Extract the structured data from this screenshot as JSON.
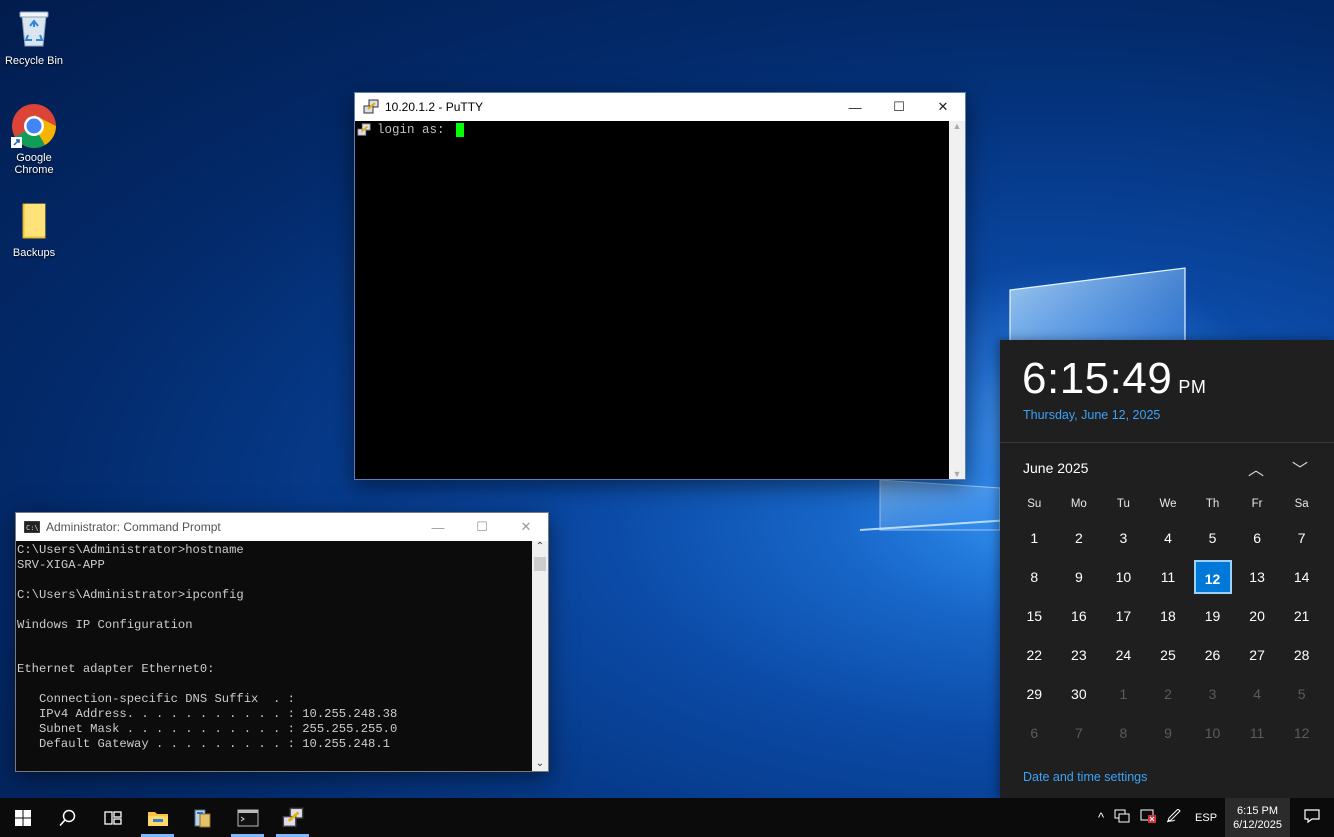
{
  "desktop": {
    "icons": [
      {
        "label": "Recycle Bin"
      },
      {
        "label": "Google\nChrome"
      },
      {
        "label": "Backups"
      }
    ]
  },
  "putty": {
    "title": "10.20.1.2 - PuTTY",
    "prompt": "login as: "
  },
  "cmd": {
    "title": "Administrator: Command Prompt",
    "output": "C:\\Users\\Administrator>hostname\nSRV-XIGA-APP\n\nC:\\Users\\Administrator>ipconfig\n\nWindows IP Configuration\n\n\nEthernet adapter Ethernet0:\n\n   Connection-specific DNS Suffix  . :\n   IPv4 Address. . . . . . . . . . . : 10.255.248.38\n   Subnet Mask . . . . . . . . . . . : 255.255.255.0\n   Default Gateway . . . . . . . . . : 10.255.248.1"
  },
  "flyout": {
    "time": "6:15:49",
    "ampm": "PM",
    "date": "Thursday, June 12, 2025",
    "month": "June 2025",
    "weekdays": [
      "Su",
      "Mo",
      "Tu",
      "We",
      "Th",
      "Fr",
      "Sa"
    ],
    "weeks": [
      [
        [
          "1",
          ""
        ],
        [
          "2",
          ""
        ],
        [
          "3",
          ""
        ],
        [
          "4",
          ""
        ],
        [
          "5",
          ""
        ],
        [
          "6",
          ""
        ],
        [
          "7",
          ""
        ]
      ],
      [
        [
          "8",
          ""
        ],
        [
          "9",
          ""
        ],
        [
          "10",
          ""
        ],
        [
          "11",
          ""
        ],
        [
          "12",
          "today"
        ],
        [
          "13",
          ""
        ],
        [
          "14",
          ""
        ]
      ],
      [
        [
          "15",
          ""
        ],
        [
          "16",
          ""
        ],
        [
          "17",
          ""
        ],
        [
          "18",
          ""
        ],
        [
          "19",
          ""
        ],
        [
          "20",
          ""
        ],
        [
          "21",
          ""
        ]
      ],
      [
        [
          "22",
          ""
        ],
        [
          "23",
          ""
        ],
        [
          "24",
          ""
        ],
        [
          "25",
          ""
        ],
        [
          "26",
          ""
        ],
        [
          "27",
          ""
        ],
        [
          "28",
          ""
        ]
      ],
      [
        [
          "29",
          ""
        ],
        [
          "30",
          ""
        ],
        [
          "1",
          "dim"
        ],
        [
          "2",
          "dim"
        ],
        [
          "3",
          "dim"
        ],
        [
          "4",
          "dim"
        ],
        [
          "5",
          "dim"
        ]
      ],
      [
        [
          "6",
          "dim"
        ],
        [
          "7",
          "dim"
        ],
        [
          "8",
          "dim"
        ],
        [
          "9",
          "dim"
        ],
        [
          "10",
          "dim"
        ],
        [
          "11",
          "dim"
        ],
        [
          "12",
          "dim"
        ]
      ]
    ],
    "settings_link": "Date and time settings"
  },
  "taskbar": {
    "lang": "ESP",
    "clock_time": "6:15 PM",
    "clock_date": "6/12/2025"
  },
  "colors": {
    "accent": "#0078d7",
    "link": "#3ea2f5",
    "cursor": "#00ff00"
  }
}
